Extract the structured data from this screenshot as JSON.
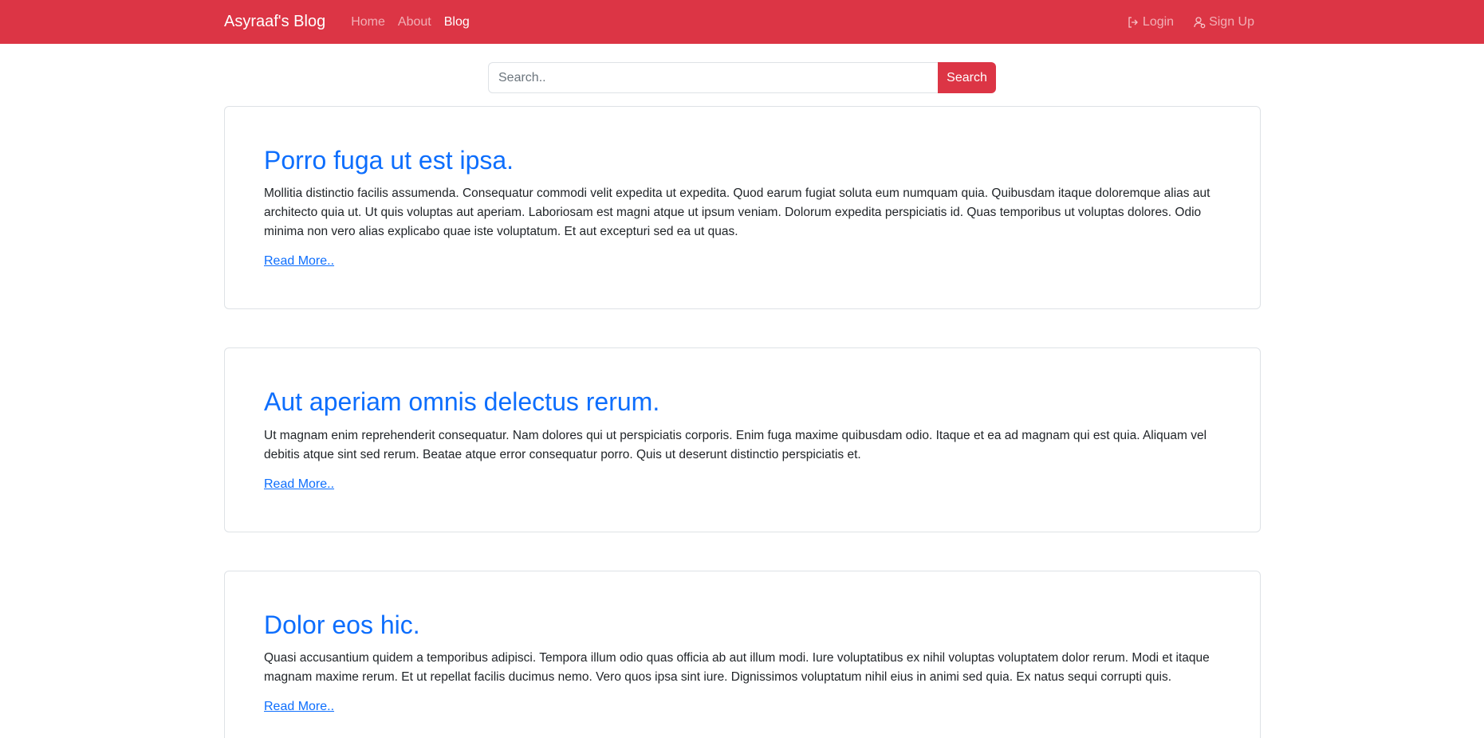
{
  "navbar": {
    "brand": "Asyraaf's Blog",
    "links": [
      {
        "label": "Home",
        "active": false
      },
      {
        "label": "About",
        "active": false
      },
      {
        "label": "Blog",
        "active": true
      }
    ],
    "login_label": "Login",
    "signup_label": "Sign Up",
    "accent_color": "#dc3545"
  },
  "search": {
    "placeholder": "Search..",
    "value": "",
    "button_label": "Search"
  },
  "posts": [
    {
      "title": "Porro fuga ut est ipsa.",
      "excerpt": "Mollitia distinctio facilis assumenda. Consequatur commodi velit expedita ut expedita. Quod earum fugiat soluta eum numquam quia. Quibusdam itaque doloremque alias aut architecto quia ut. Ut quis voluptas aut aperiam. Laboriosam est magni atque ut ipsum veniam. Dolorum expedita perspiciatis id. Quas temporibus ut voluptas dolores. Odio minima non vero alias explicabo quae iste voluptatum. Et aut excepturi sed ea ut quas.",
      "link_label": "Read More.."
    },
    {
      "title": "Aut aperiam omnis delectus rerum.",
      "excerpt": "Ut magnam enim reprehenderit consequatur. Nam dolores qui ut perspiciatis corporis. Enim fuga maxime quibusdam odio. Itaque et ea ad magnam qui est quia. Aliquam vel debitis atque sint sed rerum. Beatae atque error consequatur porro. Quis ut deserunt distinctio perspiciatis et.",
      "link_label": "Read More.."
    },
    {
      "title": "Dolor eos hic.",
      "excerpt": "Quasi accusantium quidem a temporibus adipisci. Tempora illum odio quas officia ab aut illum modi. Iure voluptatibus ex nihil voluptas voluptatem dolor rerum. Modi et itaque magnam maxime rerum. Et ut repellat facilis ducimus nemo. Vero quos ipsa sint iure. Dignissimos voluptatum nihil eius in animi sed quia. Ex natus sequi corrupti quis.",
      "link_label": "Read More.."
    }
  ]
}
